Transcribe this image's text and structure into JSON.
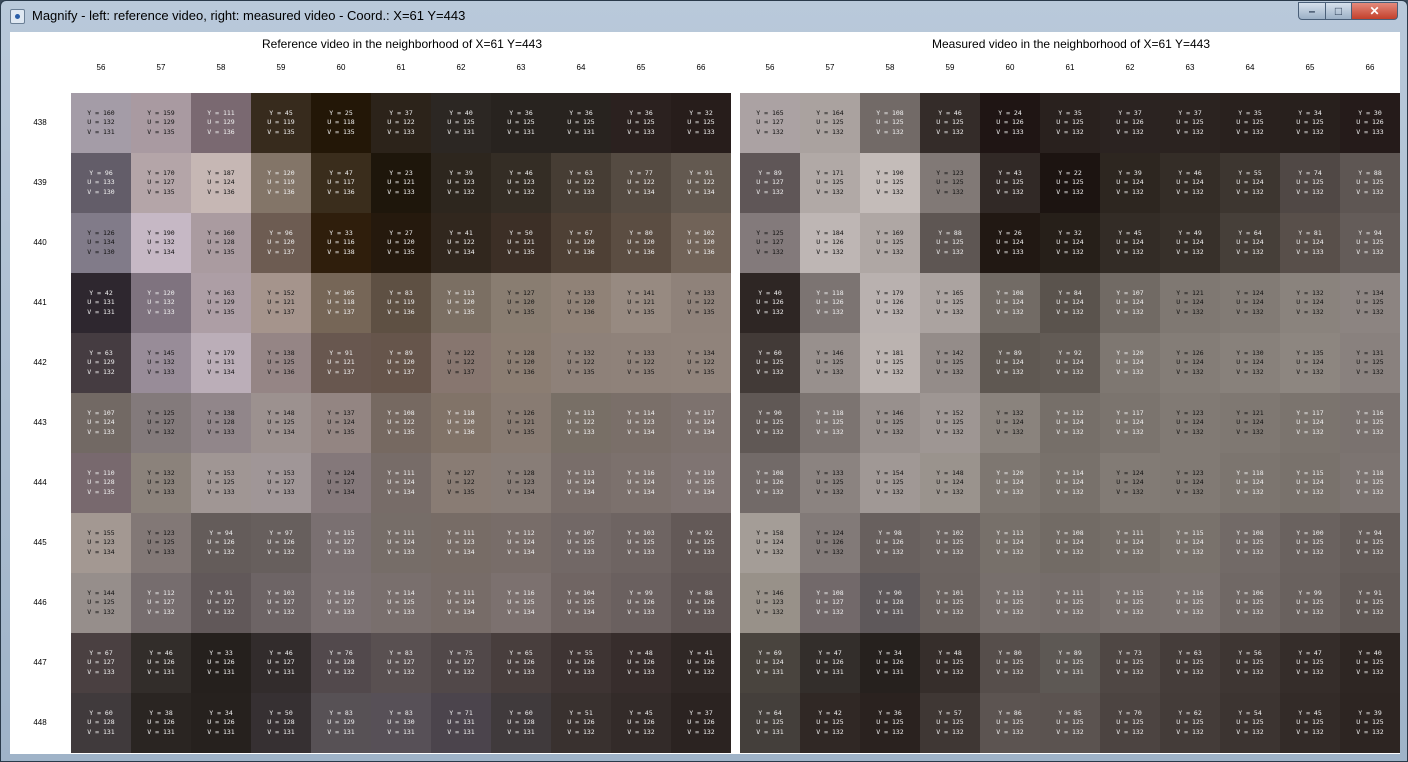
{
  "window": {
    "title": "Magnify - left: reference video, right: measured video - Coord.: X=61 Y=443",
    "minimize_glyph": "–",
    "maximize_glyph": "□",
    "close_glyph": "✕"
  },
  "columns": [
    56,
    57,
    58,
    59,
    60,
    61,
    62,
    63,
    64,
    65,
    66
  ],
  "rows": [
    438,
    439,
    440,
    441,
    442,
    443,
    444,
    445,
    446,
    447,
    448
  ],
  "reference": {
    "title": "Reference video in the neighborhood of X=61  Y=443",
    "cells": [
      [
        [
          160,
          132,
          131
        ],
        [
          159,
          129,
          135
        ],
        [
          111,
          129,
          136
        ],
        [
          45,
          119,
          135
        ],
        [
          25,
          118,
          135
        ],
        [
          37,
          122,
          133
        ],
        [
          40,
          125,
          131
        ],
        [
          36,
          125,
          131
        ],
        [
          36,
          125,
          131
        ],
        [
          36,
          125,
          133
        ],
        [
          32,
          125,
          133
        ]
      ],
      [
        [
          96,
          133,
          130
        ],
        [
          170,
          127,
          135
        ],
        [
          187,
          124,
          136
        ],
        [
          120,
          119,
          136
        ],
        [
          47,
          117,
          136
        ],
        [
          23,
          121,
          133
        ],
        [
          39,
          123,
          132
        ],
        [
          46,
          123,
          132
        ],
        [
          63,
          122,
          133
        ],
        [
          77,
          122,
          134
        ],
        [
          91,
          122,
          134
        ]
      ],
      [
        [
          126,
          134,
          130
        ],
        [
          190,
          132,
          134
        ],
        [
          160,
          128,
          135
        ],
        [
          96,
          120,
          137
        ],
        [
          33,
          116,
          138
        ],
        [
          27,
          120,
          135
        ],
        [
          41,
          122,
          134
        ],
        [
          50,
          121,
          135
        ],
        [
          67,
          120,
          136
        ],
        [
          80,
          120,
          136
        ],
        [
          102,
          120,
          136
        ]
      ],
      [
        [
          42,
          131,
          131
        ],
        [
          120,
          132,
          133
        ],
        [
          163,
          129,
          135
        ],
        [
          152,
          121,
          137
        ],
        [
          105,
          118,
          137
        ],
        [
          83,
          119,
          136
        ],
        [
          113,
          120,
          135
        ],
        [
          127,
          120,
          135
        ],
        [
          133,
          120,
          136
        ],
        [
          141,
          121,
          135
        ],
        [
          133,
          122,
          135
        ]
      ],
      [
        [
          63,
          129,
          132
        ],
        [
          145,
          132,
          133
        ],
        [
          179,
          131,
          134
        ],
        [
          138,
          125,
          136
        ],
        [
          91,
          121,
          137
        ],
        [
          89,
          120,
          137
        ],
        [
          122,
          122,
          137
        ],
        [
          128,
          120,
          136
        ],
        [
          132,
          122,
          135
        ],
        [
          133,
          122,
          135
        ],
        [
          134,
          122,
          135
        ]
      ],
      [
        [
          107,
          124,
          133
        ],
        [
          125,
          127,
          132
        ],
        [
          138,
          128,
          133
        ],
        [
          148,
          125,
          134
        ],
        [
          137,
          124,
          135
        ],
        [
          108,
          122,
          135
        ],
        [
          118,
          120,
          136
        ],
        [
          126,
          121,
          135
        ],
        [
          113,
          122,
          133
        ],
        [
          114,
          123,
          134
        ],
        [
          117,
          124,
          134
        ]
      ],
      [
        [
          110,
          128,
          135
        ],
        [
          132,
          123,
          133
        ],
        [
          153,
          125,
          133
        ],
        [
          153,
          127,
          133
        ],
        [
          124,
          127,
          134
        ],
        [
          111,
          124,
          134
        ],
        [
          127,
          122,
          135
        ],
        [
          128,
          123,
          134
        ],
        [
          113,
          124,
          134
        ],
        [
          116,
          124,
          134
        ],
        [
          119,
          125,
          134
        ]
      ],
      [
        [
          155,
          123,
          134
        ],
        [
          123,
          125,
          133
        ],
        [
          94,
          126,
          132
        ],
        [
          97,
          126,
          132
        ],
        [
          115,
          127,
          133
        ],
        [
          111,
          124,
          133
        ],
        [
          111,
          123,
          134
        ],
        [
          112,
          124,
          134
        ],
        [
          107,
          125,
          133
        ],
        [
          103,
          125,
          133
        ],
        [
          92,
          125,
          133
        ]
      ],
      [
        [
          144,
          125,
          132
        ],
        [
          112,
          127,
          132
        ],
        [
          91,
          127,
          132
        ],
        [
          103,
          127,
          132
        ],
        [
          116,
          127,
          133
        ],
        [
          114,
          125,
          133
        ],
        [
          111,
          124,
          134
        ],
        [
          116,
          125,
          134
        ],
        [
          104,
          125,
          134
        ],
        [
          99,
          126,
          133
        ],
        [
          88,
          126,
          133
        ]
      ],
      [
        [
          67,
          127,
          133
        ],
        [
          46,
          126,
          131
        ],
        [
          33,
          126,
          131
        ],
        [
          46,
          127,
          131
        ],
        [
          76,
          128,
          132
        ],
        [
          83,
          127,
          132
        ],
        [
          75,
          127,
          132
        ],
        [
          65,
          126,
          133
        ],
        [
          55,
          126,
          133
        ],
        [
          48,
          126,
          133
        ],
        [
          41,
          126,
          132
        ]
      ],
      [
        [
          60,
          128,
          131
        ],
        [
          38,
          126,
          131
        ],
        [
          34,
          126,
          131
        ],
        [
          50,
          128,
          131
        ],
        [
          83,
          129,
          131
        ],
        [
          83,
          130,
          131
        ],
        [
          71,
          131,
          131
        ],
        [
          60,
          128,
          131
        ],
        [
          51,
          126,
          132
        ],
        [
          45,
          126,
          132
        ],
        [
          37,
          126,
          132
        ]
      ]
    ]
  },
  "measured": {
    "title": "Measured video in the neighborhood of X=61  Y=443",
    "cells": [
      [
        [
          165,
          127,
          132
        ],
        [
          164,
          125,
          132
        ],
        [
          108,
          125,
          132
        ],
        [
          46,
          125,
          132
        ],
        [
          24,
          126,
          133
        ],
        [
          35,
          125,
          132
        ],
        [
          37,
          126,
          132
        ],
        [
          37,
          125,
          132
        ],
        [
          35,
          125,
          132
        ],
        [
          34,
          125,
          132
        ],
        [
          30,
          126,
          133
        ]
      ],
      [
        [
          89,
          127,
          132
        ],
        [
          171,
          125,
          132
        ],
        [
          190,
          125,
          132
        ],
        [
          123,
          125,
          132
        ],
        [
          43,
          125,
          132
        ],
        [
          22,
          125,
          132
        ],
        [
          39,
          124,
          132
        ],
        [
          46,
          124,
          132
        ],
        [
          55,
          124,
          132
        ],
        [
          74,
          125,
          132
        ],
        [
          88,
          125,
          132
        ]
      ],
      [
        [
          125,
          127,
          132
        ],
        [
          184,
          126,
          132
        ],
        [
          169,
          125,
          132
        ],
        [
          88,
          125,
          132
        ],
        [
          26,
          124,
          133
        ],
        [
          32,
          124,
          132
        ],
        [
          45,
          124,
          132
        ],
        [
          49,
          124,
          132
        ],
        [
          64,
          124,
          132
        ],
        [
          81,
          124,
          133
        ],
        [
          94,
          125,
          132
        ]
      ],
      [
        [
          40,
          126,
          132
        ],
        [
          118,
          126,
          132
        ],
        [
          179,
          126,
          132
        ],
        [
          165,
          125,
          132
        ],
        [
          108,
          124,
          132
        ],
        [
          84,
          124,
          132
        ],
        [
          107,
          124,
          132
        ],
        [
          121,
          124,
          132
        ],
        [
          124,
          124,
          132
        ],
        [
          132,
          124,
          132
        ],
        [
          134,
          125,
          132
        ]
      ],
      [
        [
          60,
          125,
          132
        ],
        [
          146,
          125,
          132
        ],
        [
          181,
          125,
          132
        ],
        [
          142,
          125,
          132
        ],
        [
          89,
          124,
          132
        ],
        [
          92,
          124,
          132
        ],
        [
          120,
          124,
          132
        ],
        [
          126,
          124,
          132
        ],
        [
          130,
          124,
          132
        ],
        [
          135,
          124,
          132
        ],
        [
          131,
          125,
          132
        ]
      ],
      [
        [
          90,
          125,
          132
        ],
        [
          118,
          125,
          132
        ],
        [
          146,
          125,
          132
        ],
        [
          152,
          125,
          132
        ],
        [
          132,
          124,
          132
        ],
        [
          112,
          124,
          132
        ],
        [
          117,
          124,
          132
        ],
        [
          123,
          124,
          132
        ],
        [
          121,
          124,
          132
        ],
        [
          117,
          124,
          132
        ],
        [
          116,
          125,
          132
        ]
      ],
      [
        [
          108,
          126,
          132
        ],
        [
          133,
          125,
          132
        ],
        [
          154,
          125,
          132
        ],
        [
          148,
          124,
          132
        ],
        [
          120,
          124,
          132
        ],
        [
          114,
          124,
          132
        ],
        [
          124,
          124,
          132
        ],
        [
          123,
          124,
          132
        ],
        [
          118,
          124,
          132
        ],
        [
          115,
          124,
          132
        ],
        [
          118,
          125,
          132
        ]
      ],
      [
        [
          158,
          124,
          132
        ],
        [
          124,
          126,
          132
        ],
        [
          98,
          126,
          132
        ],
        [
          102,
          125,
          132
        ],
        [
          113,
          124,
          132
        ],
        [
          108,
          124,
          132
        ],
        [
          111,
          124,
          132
        ],
        [
          115,
          124,
          132
        ],
        [
          108,
          125,
          132
        ],
        [
          100,
          125,
          132
        ],
        [
          94,
          125,
          132
        ]
      ],
      [
        [
          146,
          123,
          132
        ],
        [
          108,
          127,
          132
        ],
        [
          90,
          128,
          131
        ],
        [
          101,
          125,
          132
        ],
        [
          113,
          125,
          132
        ],
        [
          111,
          125,
          132
        ],
        [
          115,
          125,
          132
        ],
        [
          116,
          125,
          132
        ],
        [
          106,
          125,
          132
        ],
        [
          99,
          125,
          132
        ],
        [
          91,
          125,
          132
        ]
      ],
      [
        [
          69,
          124,
          131
        ],
        [
          47,
          126,
          131
        ],
        [
          34,
          126,
          131
        ],
        [
          48,
          125,
          132
        ],
        [
          80,
          125,
          132
        ],
        [
          89,
          125,
          131
        ],
        [
          73,
          125,
          132
        ],
        [
          63,
          125,
          132
        ],
        [
          56,
          125,
          132
        ],
        [
          47,
          125,
          132
        ],
        [
          40,
          125,
          132
        ]
      ],
      [
        [
          64,
          125,
          131
        ],
        [
          42,
          125,
          132
        ],
        [
          36,
          125,
          132
        ],
        [
          57,
          125,
          132
        ],
        [
          86,
          125,
          132
        ],
        [
          85,
          125,
          132
        ],
        [
          70,
          125,
          132
        ],
        [
          62,
          125,
          132
        ],
        [
          54,
          125,
          132
        ],
        [
          45,
          125,
          132
        ],
        [
          39,
          125,
          132
        ]
      ]
    ]
  }
}
